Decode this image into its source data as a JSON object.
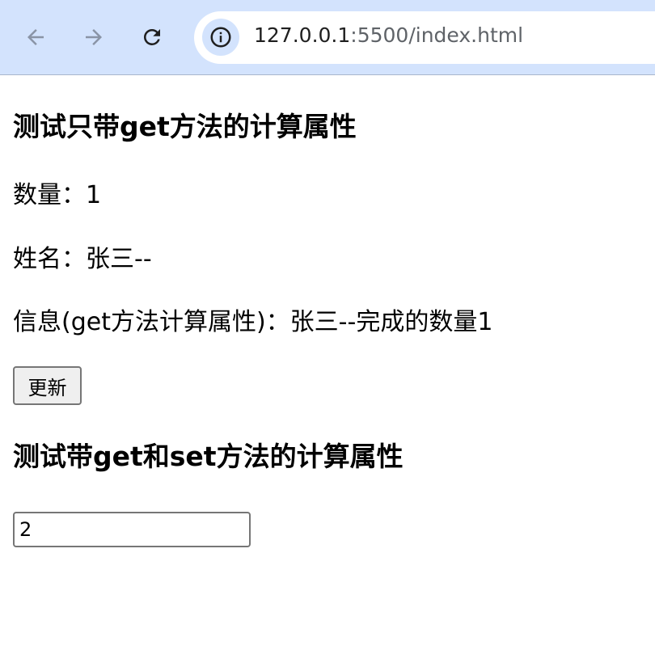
{
  "browser": {
    "url_host": "127.0.0.1",
    "url_rest": ":5500/index.html",
    "icons": {
      "back": "arrow-left-icon",
      "forward": "arrow-right-icon",
      "reload": "reload-icon",
      "site_info": "info-icon"
    }
  },
  "page": {
    "heading1": "测试只带get方法的计算属性",
    "count_line": "数量：1",
    "name_line": "姓名：张三--",
    "info_line": "信息(get方法计算属性)：张三--完成的数量1",
    "update_button": "更新",
    "heading2": "测试带get和set方法的计算属性",
    "input_value": "2"
  }
}
